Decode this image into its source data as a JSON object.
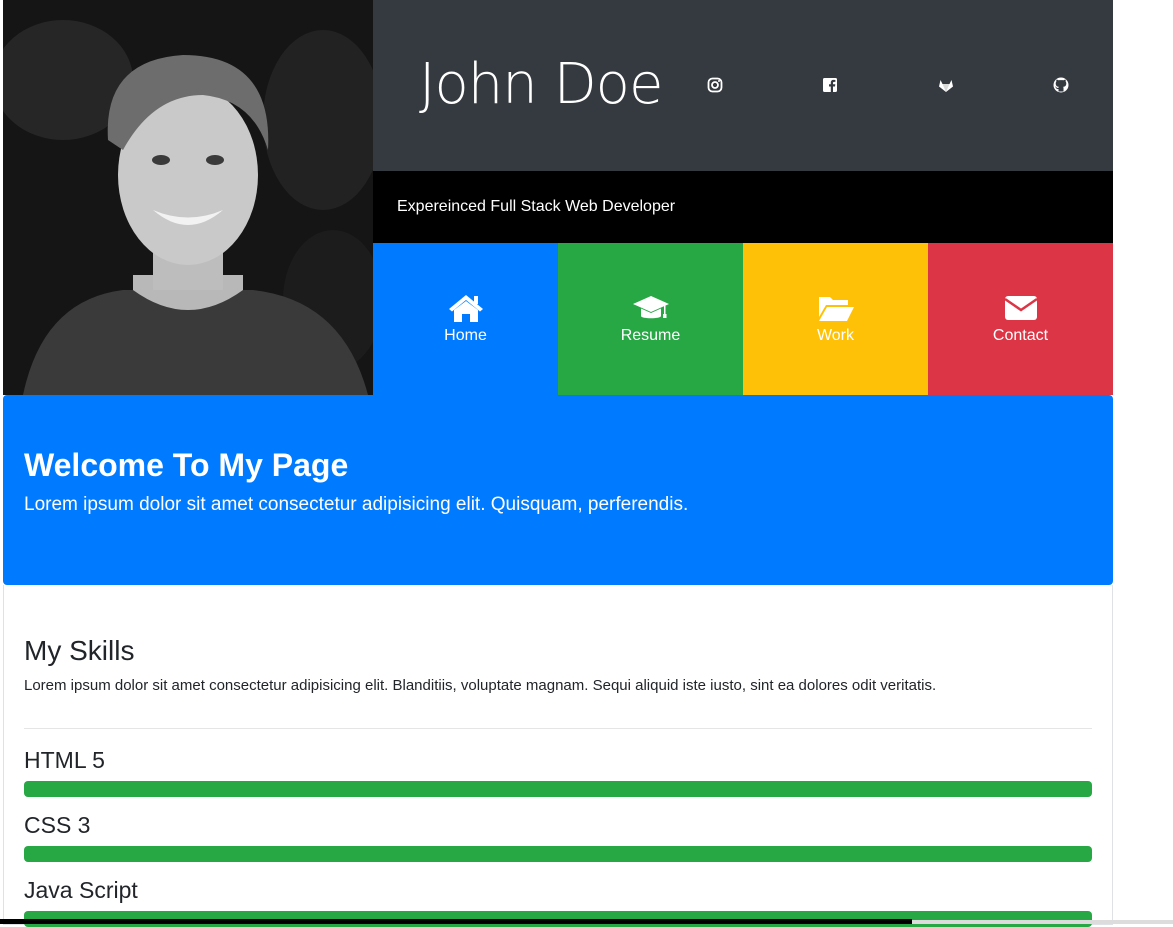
{
  "header": {
    "name": "John Doe",
    "tagline": "Expereinced Full Stack Web Developer",
    "socials": [
      {
        "icon": "instagram-icon"
      },
      {
        "icon": "facebook-icon"
      },
      {
        "icon": "gitlab-icon"
      },
      {
        "icon": "github-icon"
      }
    ]
  },
  "menu": {
    "items": [
      {
        "label": "Home",
        "icon": "home-icon",
        "color": "#007bff"
      },
      {
        "label": "Resume",
        "icon": "graduation-cap-icon",
        "color": "#28a745"
      },
      {
        "label": "Work",
        "icon": "folder-open-icon",
        "color": "#ffc107"
      },
      {
        "label": "Contact",
        "icon": "envelope-icon",
        "color": "#dc3545"
      }
    ]
  },
  "welcome": {
    "title": "Welcome To My Page",
    "text": "Lorem ipsum dolor sit amet consectetur adipisicing elit. Quisquam, perferendis."
  },
  "skills": {
    "title": "My Skills",
    "description": "Lorem ipsum dolor sit amet consectetur adipisicing elit. Blanditiis, voluptate magnam. Sequi aliquid iste iusto, sint ea dolores odit veritatis.",
    "items": [
      {
        "name": "HTML 5",
        "percent": 100
      },
      {
        "name": "CSS 3",
        "percent": 100
      },
      {
        "name": "Java Script",
        "percent": 100
      }
    ]
  },
  "colors": {
    "primary": "#007bff",
    "success": "#28a745",
    "warning": "#ffc107",
    "danger": "#dc3545",
    "dark": "#343a40"
  }
}
